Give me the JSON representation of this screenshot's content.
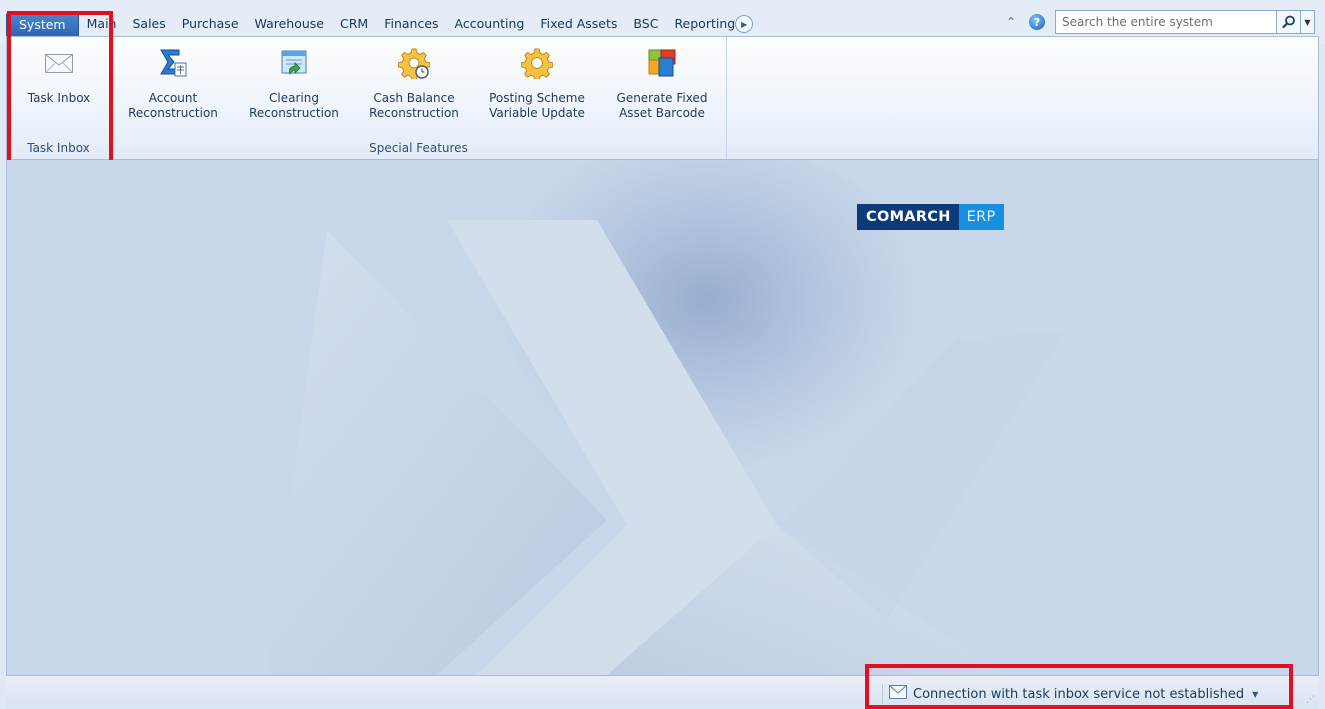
{
  "tabs": [
    {
      "label": "System",
      "active": true
    },
    {
      "label": "Main"
    },
    {
      "label": "Sales"
    },
    {
      "label": "Purchase"
    },
    {
      "label": "Warehouse"
    },
    {
      "label": "CRM"
    },
    {
      "label": "Finances"
    },
    {
      "label": "Accounting"
    },
    {
      "label": "Fixed Assets"
    },
    {
      "label": "BSC"
    },
    {
      "label": "Reporting"
    }
  ],
  "search": {
    "placeholder": "Search the entire system"
  },
  "ribbon": {
    "groups": [
      {
        "label": "Task Inbox",
        "buttons": [
          {
            "label": "Task Inbox",
            "icon": "envelope-icon"
          }
        ]
      },
      {
        "label": "Special Features",
        "buttons": [
          {
            "label": "Account\nReconstruction",
            "icon": "sigma-icon"
          },
          {
            "label": "Clearing\nReconstruction",
            "icon": "clearing-icon"
          },
          {
            "label": "Cash Balance\nReconstruction",
            "icon": "gear-clock-icon"
          },
          {
            "label": "Posting Scheme\nVariable Update",
            "icon": "gear-icon"
          },
          {
            "label": "Generate Fixed\nAsset Barcode",
            "icon": "barcode-blocks-icon"
          }
        ]
      }
    ]
  },
  "logo": {
    "part1": "COMARCH",
    "part2": "ERP"
  },
  "status": {
    "message": "Connection with task inbox service not established"
  },
  "colors": {
    "accent": "#2d66b3",
    "highlight": "#e0101e",
    "logo_dark": "#0d3a78",
    "logo_light": "#1790e0"
  }
}
